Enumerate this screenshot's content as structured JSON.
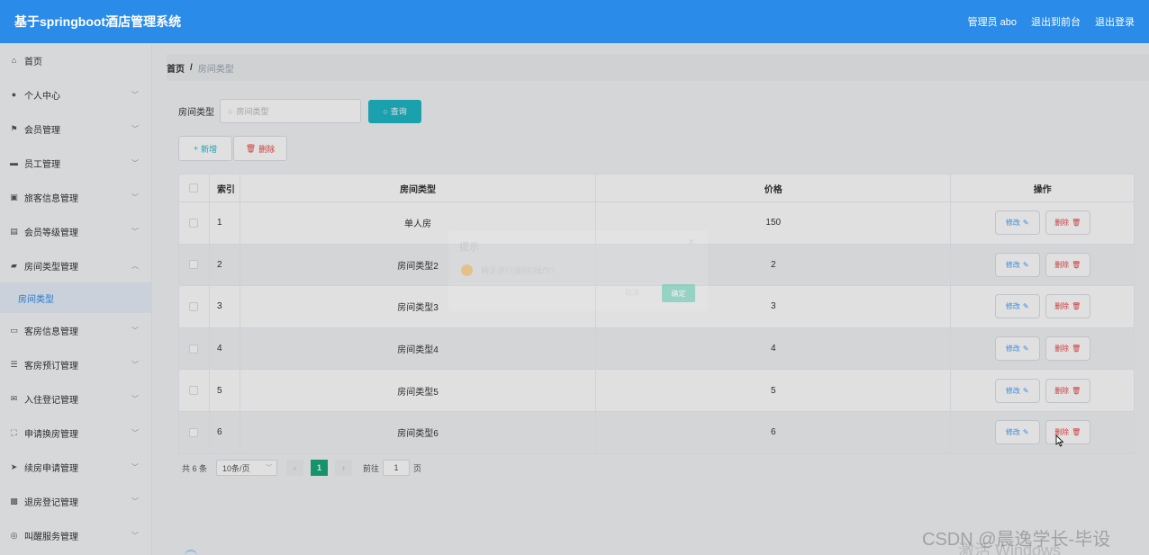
{
  "header": {
    "title": "基于springboot酒店管理系统",
    "user": "管理员 abo",
    "to_front": "退出到前台",
    "logout": "退出登录"
  },
  "sidebar": {
    "items": [
      {
        "label": "首页",
        "icon": "home-icon",
        "expandable": false
      },
      {
        "label": "个人中心",
        "icon": "user-icon",
        "expandable": true
      },
      {
        "label": "会员管理",
        "icon": "flag-icon",
        "expandable": true
      },
      {
        "label": "员工管理",
        "icon": "monitor-icon",
        "expandable": true
      },
      {
        "label": "旅客信息管理",
        "icon": "clipboard-icon",
        "expandable": true
      },
      {
        "label": "会员等级管理",
        "icon": "document-icon",
        "expandable": true
      },
      {
        "label": "房间类型管理",
        "icon": "briefcase-icon",
        "expandable": true,
        "expanded": true
      },
      {
        "label": "客房信息管理",
        "icon": "chat-icon",
        "expandable": true
      },
      {
        "label": "客房预订管理",
        "icon": "sliders-icon",
        "expandable": true
      },
      {
        "label": "入住登记管理",
        "icon": "mail-icon",
        "expandable": true
      },
      {
        "label": "申请换房管理",
        "icon": "fullscreen-icon",
        "expandable": true
      },
      {
        "label": "续房申请管理",
        "icon": "send-icon",
        "expandable": true
      },
      {
        "label": "退房登记管理",
        "icon": "ticket-icon",
        "expandable": true
      },
      {
        "label": "叫醒服务管理",
        "icon": "clock-icon",
        "expandable": true
      }
    ],
    "sub_item": "房间类型"
  },
  "breadcrumb": {
    "home": "首页",
    "sep": "/",
    "current": "房间类型"
  },
  "search": {
    "label": "房间类型",
    "placeholder": "房间类型",
    "button": "查询"
  },
  "actions": {
    "add": "新增",
    "delete": "删除"
  },
  "table": {
    "headers": {
      "index": "索引",
      "type": "房间类型",
      "price": "价格",
      "ops": "操作"
    },
    "rows": [
      {
        "index": "1",
        "type": "单人房",
        "price": "150"
      },
      {
        "index": "2",
        "type": "房间类型2",
        "price": "2"
      },
      {
        "index": "3",
        "type": "房间类型3",
        "price": "3"
      },
      {
        "index": "4",
        "type": "房间类型4",
        "price": "4"
      },
      {
        "index": "5",
        "type": "房间类型5",
        "price": "5"
      },
      {
        "index": "6",
        "type": "房间类型6",
        "price": "6"
      }
    ],
    "edit_label": "修改",
    "delete_label": "删除"
  },
  "pager": {
    "total": "共 6 条",
    "page_size": "10条/页",
    "current_page": "1",
    "goto": "前往",
    "goto_value": "1",
    "page_unit": "页"
  },
  "dialog": {
    "title": "提示",
    "message": "确定进行[删除]操作?",
    "cancel": "取消",
    "confirm": "确定"
  },
  "watermark": "CSDN @晨逸学长-毕设",
  "windows_mark": "激活 Windows",
  "colors": {
    "header": "#2a8be8",
    "search_button": "#1fb8c5",
    "danger": "#e84a4a",
    "active_page": "#1aa87a"
  }
}
